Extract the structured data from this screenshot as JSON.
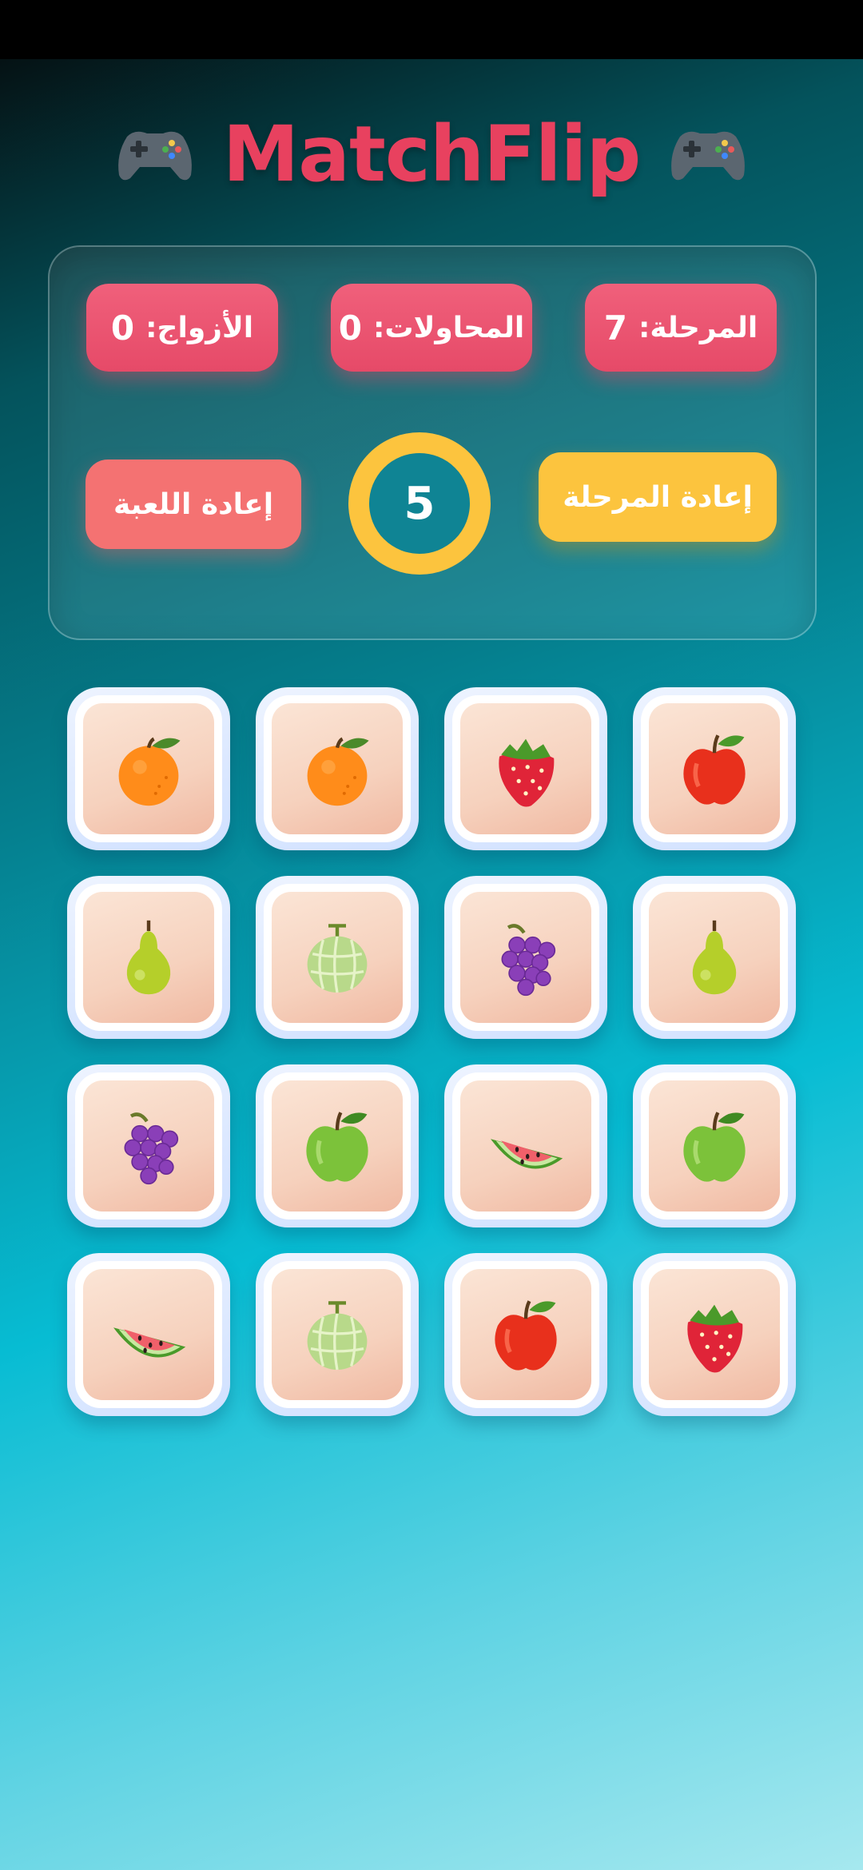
{
  "app": {
    "title": "MatchFlip"
  },
  "stats": {
    "level": {
      "label": "المرحلة:",
      "value": "7"
    },
    "attempts": {
      "label": "المحاولات:",
      "value": "0"
    },
    "pairs": {
      "label": "الأزواج:",
      "value": "0"
    }
  },
  "controls": {
    "restart_level": "إعادة المرحلة",
    "restart_game": "إعادة اللعبة",
    "timer": "5"
  },
  "icons": {
    "title_left": "gamepad-icon",
    "title_right": "gamepad-icon"
  },
  "colors": {
    "accent": "#e8415f",
    "stat_bg": "#ec5470",
    "gold": "#fcc43e",
    "restart_game": "#f47272"
  },
  "board": {
    "rows": 4,
    "cols": 4,
    "cards": [
      "orange",
      "orange",
      "strawberry",
      "red-apple",
      "pear",
      "melon",
      "grapes",
      "pear",
      "grapes",
      "green-apple",
      "watermelon",
      "green-apple",
      "watermelon",
      "melon",
      "red-apple",
      "strawberry"
    ]
  }
}
